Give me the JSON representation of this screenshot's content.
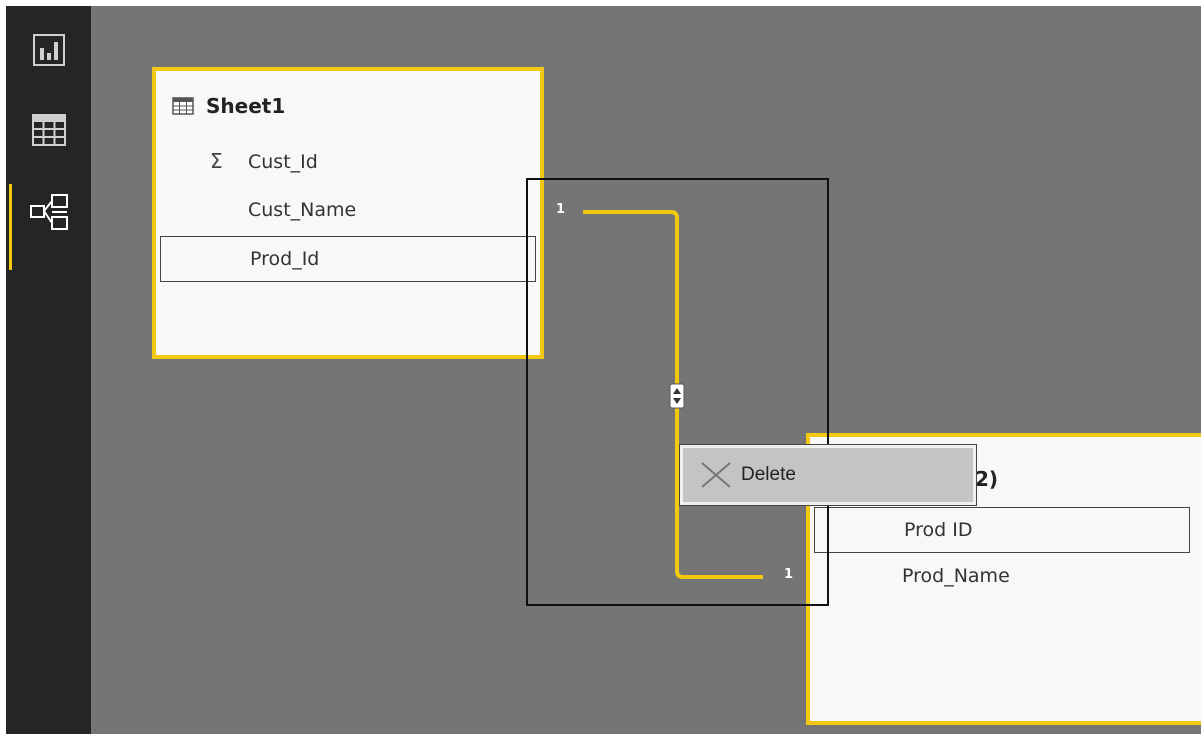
{
  "sidebar": {
    "items": [
      {
        "name": "report-view",
        "icon": "bar-chart-icon",
        "active": false
      },
      {
        "name": "data-view",
        "icon": "table-grid-icon",
        "active": false
      },
      {
        "name": "relationships-view",
        "icon": "relationship-diagram-icon",
        "active": true
      }
    ]
  },
  "tables": {
    "sheet1": {
      "title": "Sheet1",
      "icon": "table-icon",
      "fields": [
        {
          "label": "Cust_Id",
          "aggregate_icon": "Σ"
        },
        {
          "label": "Cust_Name"
        },
        {
          "label": "Prod_Id",
          "highlighted": true
        }
      ]
    },
    "sheet2": {
      "title_visible_fragment": "2)",
      "fields": [
        {
          "label": "Prod ID",
          "highlighted": true
        },
        {
          "label": "Prod_Name"
        }
      ]
    }
  },
  "relationship": {
    "from_cardinality": "1",
    "to_cardinality": "1",
    "cross_filter_icon": "bidirectional-arrow-icon"
  },
  "context_menu": {
    "items": [
      {
        "label": "Delete",
        "icon": "close-x-icon"
      }
    ]
  },
  "colors": {
    "accent": "#f2c811",
    "canvas": "#757575",
    "sidebar": "#252525",
    "card": "#f8f8f8"
  }
}
